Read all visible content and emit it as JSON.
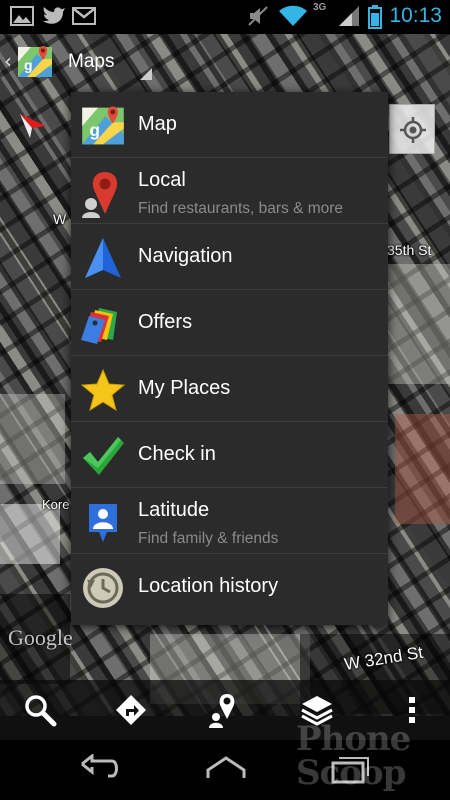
{
  "status_bar": {
    "time": "10:13",
    "network": "3G",
    "icons": [
      "picture-icon",
      "twitter-icon",
      "gmail-icon",
      "mute-icon",
      "wifi-icon",
      "signal-icon",
      "battery-icon"
    ]
  },
  "action_bar": {
    "title": "Maps",
    "app_icon": "maps-icon"
  },
  "map": {
    "streets": [
      "W",
      "35th St",
      "Kore",
      "W 32nd St"
    ],
    "attribution": "Google"
  },
  "menu": {
    "items": [
      {
        "label": "Map",
        "subtitle": "",
        "icon": "maps-icon"
      },
      {
        "label": "Local",
        "subtitle": "Find restaurants, bars & more",
        "icon": "local-pin-icon"
      },
      {
        "label": "Navigation",
        "subtitle": "",
        "icon": "navigation-arrow-icon"
      },
      {
        "label": "Offers",
        "subtitle": "",
        "icon": "offers-tags-icon"
      },
      {
        "label": "My Places",
        "subtitle": "",
        "icon": "star-icon"
      },
      {
        "label": "Check in",
        "subtitle": "",
        "icon": "checkmark-icon"
      },
      {
        "label": "Latitude",
        "subtitle": "Find family & friends",
        "icon": "latitude-icon"
      },
      {
        "label": "Location history",
        "subtitle": "",
        "icon": "history-clock-icon"
      }
    ]
  },
  "toolbar": {
    "buttons": [
      "search-icon",
      "directions-icon",
      "places-icon",
      "layers-icon",
      "overflow-icon"
    ]
  },
  "nav_bar": {
    "buttons": [
      "back-icon",
      "home-icon",
      "recent-apps-icon"
    ]
  },
  "watermark": "Phone Scoop",
  "colors": {
    "accent": "#33b5e5",
    "menu_bg": "#2b2b2b"
  }
}
